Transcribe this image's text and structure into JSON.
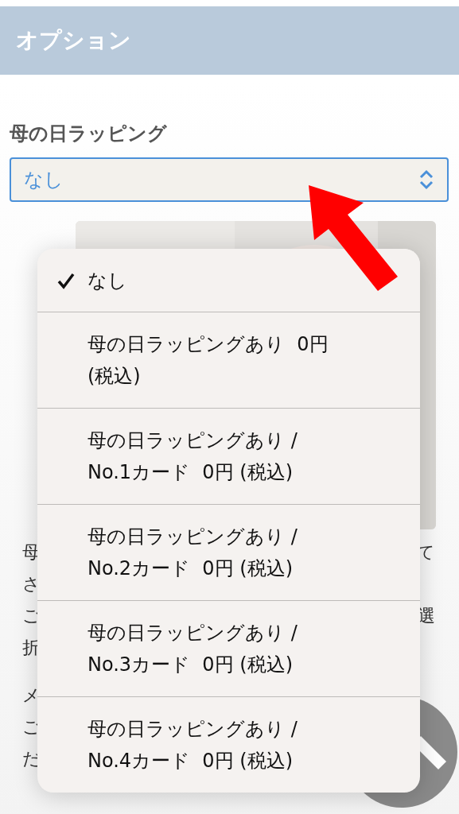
{
  "header": {
    "title": "オプション"
  },
  "field": {
    "label": "母の日ラッピング",
    "value": "なし"
  },
  "background_paragraphs": [
    [
      {
        "left": "母",
        "right": "て"
      },
      {
        "left": "さ"
      },
      {
        "left": "ご",
        "right": "選"
      },
      {
        "left": "折"
      }
    ],
    [
      {
        "left": "メ"
      },
      {
        "left": "ご"
      },
      {
        "left": "だ"
      }
    ]
  ],
  "dropdown": {
    "options": [
      {
        "lines": [
          "なし"
        ],
        "selected": true
      },
      {
        "lines": [
          "母の日ラッピングあり  0円",
          "(税込)"
        ],
        "selected": false
      },
      {
        "lines": [
          "母の日ラッピングあり /",
          "No.1カード  0円 (税込)"
        ],
        "selected": false
      },
      {
        "lines": [
          "母の日ラッピングあり /",
          "No.2カード  0円 (税込)"
        ],
        "selected": false
      },
      {
        "lines": [
          "母の日ラッピングあり /",
          "No.3カード  0円 (税込)"
        ],
        "selected": false
      },
      {
        "lines": [
          "母の日ラッピングあり /",
          "No.4カード  0円 (税込)"
        ],
        "selected": false
      }
    ]
  }
}
